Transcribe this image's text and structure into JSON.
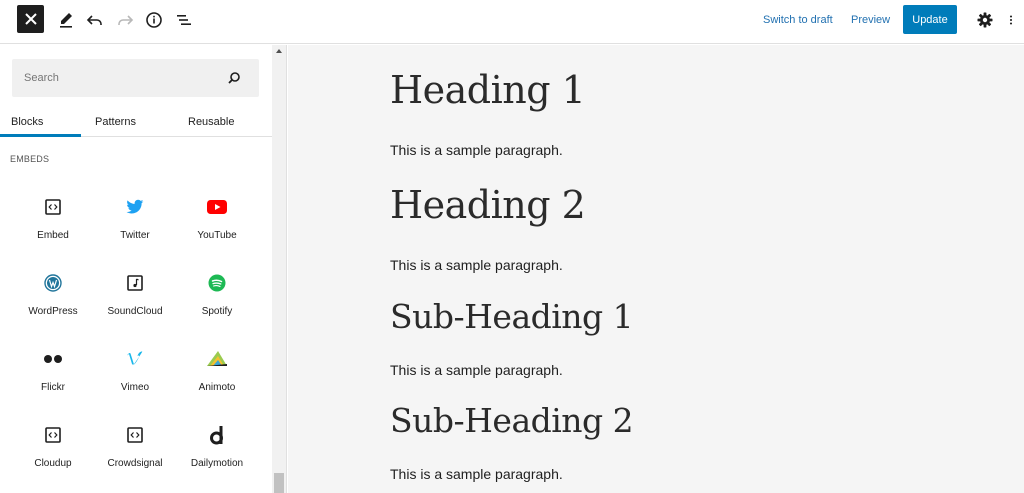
{
  "toolbar": {
    "switch_to_draft": "Switch to draft",
    "preview": "Preview",
    "update": "Update"
  },
  "sidebar": {
    "search_placeholder": "Search",
    "tabs": [
      "Blocks",
      "Patterns",
      "Reusable"
    ],
    "active_tab": "Blocks",
    "section_label": "EMBEDS",
    "blocks": [
      {
        "label": "Embed",
        "icon": "embed-icon"
      },
      {
        "label": "Twitter",
        "icon": "twitter-icon"
      },
      {
        "label": "YouTube",
        "icon": "youtube-icon"
      },
      {
        "label": "WordPress",
        "icon": "wordpress-icon"
      },
      {
        "label": "SoundCloud",
        "icon": "soundcloud-icon"
      },
      {
        "label": "Spotify",
        "icon": "spotify-icon"
      },
      {
        "label": "Flickr",
        "icon": "flickr-icon"
      },
      {
        "label": "Vimeo",
        "icon": "vimeo-icon"
      },
      {
        "label": "Animoto",
        "icon": "animoto-icon"
      },
      {
        "label": "Cloudup",
        "icon": "cloudup-icon"
      },
      {
        "label": "Crowdsignal",
        "icon": "crowdsignal-icon"
      },
      {
        "label": "Dailymotion",
        "icon": "dailymotion-icon"
      }
    ]
  },
  "content": {
    "heading_1": "Heading 1",
    "paragraph_1": "This is a sample paragraph.",
    "heading_2": "Heading 2",
    "paragraph_2": "This is a sample paragraph.",
    "subheading_1": "Sub-Heading 1",
    "paragraph_3": "This is a sample paragraph.",
    "subheading_2": "Sub-Heading 2",
    "paragraph_4": "This is a sample paragraph."
  },
  "colors": {
    "accent": "#007cba",
    "twitter": "#1da1f2",
    "youtube": "#ff0000",
    "spotify": "#1db954",
    "vimeo": "#1ab7ea",
    "wordpress": "#21759b"
  }
}
